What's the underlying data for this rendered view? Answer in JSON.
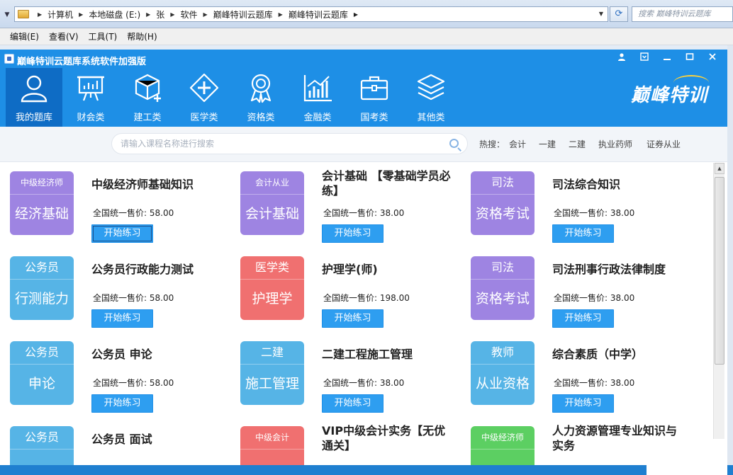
{
  "explorer": {
    "breadcrumbs": [
      "计算机",
      "本地磁盘 (E:)",
      "张",
      "软件",
      "巅峰特训云题库",
      "巅峰特训云题库"
    ],
    "search_placeholder": "搜索 巅峰特训云题库",
    "menu": [
      "编辑(E)",
      "查看(V)",
      "工具(T)",
      "帮助(H)"
    ]
  },
  "app": {
    "title": "巅峰特训云题库系统软件加强版",
    "brand": "巅峰特训",
    "nav": [
      {
        "label": "我的题库",
        "icon": "user-icon",
        "active": true
      },
      {
        "label": "财会类",
        "icon": "presentation-board-icon",
        "active": false
      },
      {
        "label": "建工类",
        "icon": "cube-plus-icon",
        "active": false
      },
      {
        "label": "医学类",
        "icon": "medical-cross-icon",
        "active": false
      },
      {
        "label": "资格类",
        "icon": "award-ribbon-icon",
        "active": false
      },
      {
        "label": "金融类",
        "icon": "bar-chart-icon",
        "active": false
      },
      {
        "label": "国考类",
        "icon": "briefcase-icon",
        "active": false
      },
      {
        "label": "其他类",
        "icon": "layers-icon",
        "active": false
      }
    ],
    "search": {
      "placeholder": "请输入课程名称进行搜索",
      "hot_label": "热搜：",
      "hot_tags": [
        "会计",
        "一建",
        "二建",
        "执业药师",
        "证券从业"
      ]
    },
    "courses": [
      {
        "badge_top": "中级经济师",
        "badge_main": "经济基础",
        "color": "#9e84e2",
        "title": "中级经济师基础知识",
        "price": "全国统一售价: 58.00",
        "button": "开始练习"
      },
      {
        "badge_top": "会计从业",
        "badge_main": "会计基础",
        "color": "#9e84e2",
        "title": "会计基础 【零基础学员必练】",
        "price": "全国统一售价: 38.00",
        "button": "开始练习"
      },
      {
        "badge_top": "司法",
        "badge_main": "资格考试",
        "color": "#9e84e2",
        "title": "司法综合知识",
        "price": "全国统一售价: 38.00",
        "button": "开始练习"
      },
      {
        "badge_top": "公务员",
        "badge_main": "行测能力",
        "color": "#56b4e6",
        "title": "公务员行政能力测试",
        "price": "全国统一售价: 58.00",
        "button": "开始练习"
      },
      {
        "badge_top": "医学类",
        "badge_main": "护理学",
        "color": "#f07070",
        "title": "护理学(师)",
        "price": "全国统一售价: 198.00",
        "button": "开始练习"
      },
      {
        "badge_top": "司法",
        "badge_main": "资格考试",
        "color": "#9e84e2",
        "title": "司法刑事行政法律制度",
        "price": "全国统一售价: 38.00",
        "button": "开始练习"
      },
      {
        "badge_top": "公务员",
        "badge_main": "申论",
        "color": "#56b4e6",
        "title": "公务员 申论",
        "price": "全国统一售价: 58.00",
        "button": "开始练习"
      },
      {
        "badge_top": "二建",
        "badge_main": "施工管理",
        "color": "#56b4e6",
        "title": "二建工程施工管理",
        "price": "全国统一售价: 38.00",
        "button": "开始练习"
      },
      {
        "badge_top": "教师",
        "badge_main": "从业资格",
        "color": "#56b4e6",
        "title": "综合素质（中学）",
        "price": "全国统一售价: 38.00",
        "button": "开始练习"
      },
      {
        "badge_top": "公务员",
        "badge_main": "",
        "color": "#56b4e6",
        "title": "公务员 面试",
        "price": "",
        "button": ""
      },
      {
        "badge_top": "中级会计",
        "badge_main": "",
        "color": "#f07070",
        "title": "VIP中级会计实务【无优通关】",
        "price": "",
        "button": ""
      },
      {
        "badge_top": "中级经济师",
        "badge_main": "",
        "color": "#5ccf62",
        "title": "人力资源管理专业知识与实务",
        "price": "",
        "button": ""
      }
    ]
  }
}
